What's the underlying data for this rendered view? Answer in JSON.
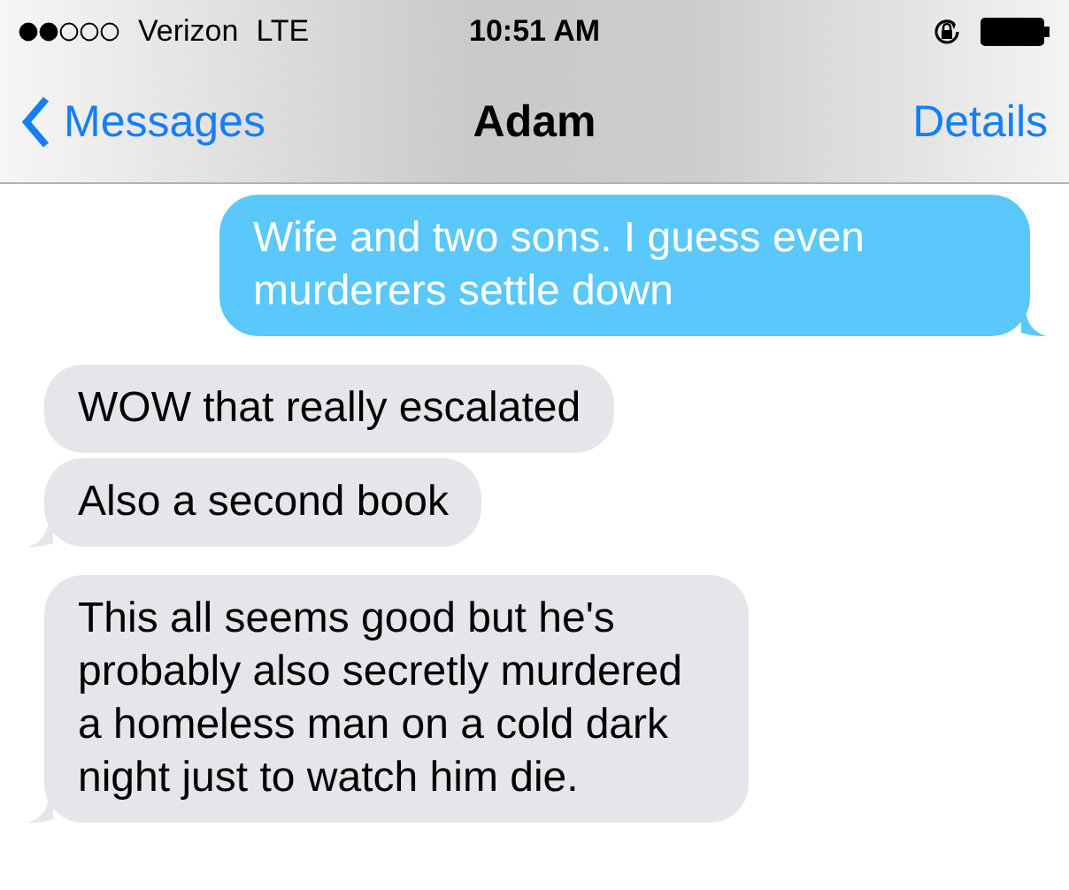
{
  "status_bar": {
    "carrier": "Verizon",
    "network": "LTE",
    "time": "10:51 AM"
  },
  "nav": {
    "back": "Messages",
    "title": "Adam",
    "action": "Details"
  },
  "messages": [
    {
      "text": "Wife and two sons. I guess even murderers settle down",
      "kind": "sent",
      "tail": true
    },
    {
      "text": "WOW that really escalated",
      "kind": "received",
      "tail": false
    },
    {
      "text": "Also a second book",
      "kind": "received",
      "tail": true
    },
    {
      "text": "This all seems good but he's probably also secretly murdered a homeless man on a cold dark night just to watch him die.",
      "kind": "received",
      "tail": true
    }
  ]
}
